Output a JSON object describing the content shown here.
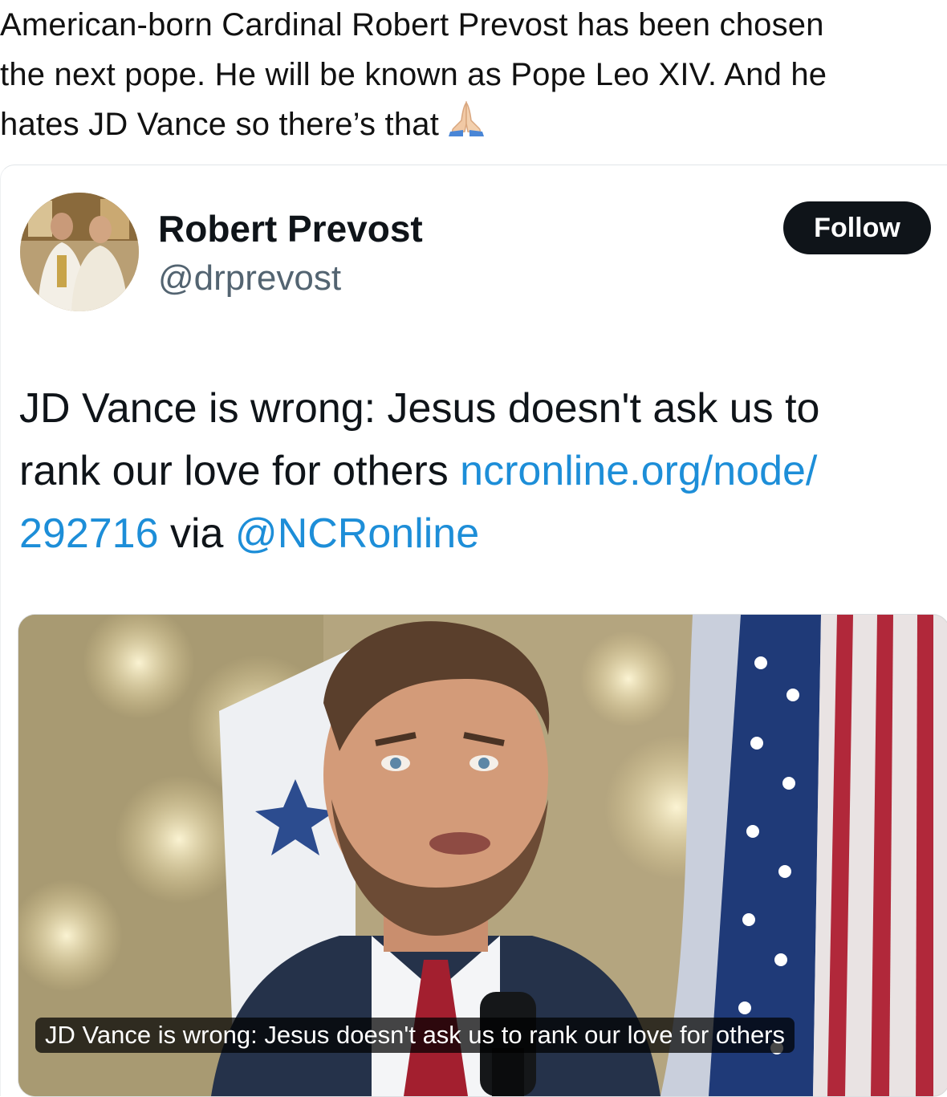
{
  "post": {
    "caption_lines": [
      "American-born Cardinal Robert Prevost has been chosen",
      "the next pope. He will be known as Pope Leo XIV. And he",
      "hates JD Vance so there’s that"
    ],
    "caption_emoji": "folded-hands-icon"
  },
  "embed": {
    "author_name": "Robert Prevost",
    "author_handle": "@drprevost",
    "follow_label": "Follow",
    "text_line1": "JD Vance is wrong: Jesus doesn't ask us to",
    "text_line2_plain": "rank our love for others ",
    "text_line2_link": "ncronline.org/node/",
    "text_line3_link": "292716",
    "text_line3_plain": " via ",
    "text_line3_mention": "@NCRonline",
    "media_caption": "JD Vance is wrong: Jesus doesn't ask us to rank our love for others"
  },
  "colors": {
    "link": "#1d8ed8",
    "follow_bg": "#0f1419",
    "handle": "#536471"
  }
}
